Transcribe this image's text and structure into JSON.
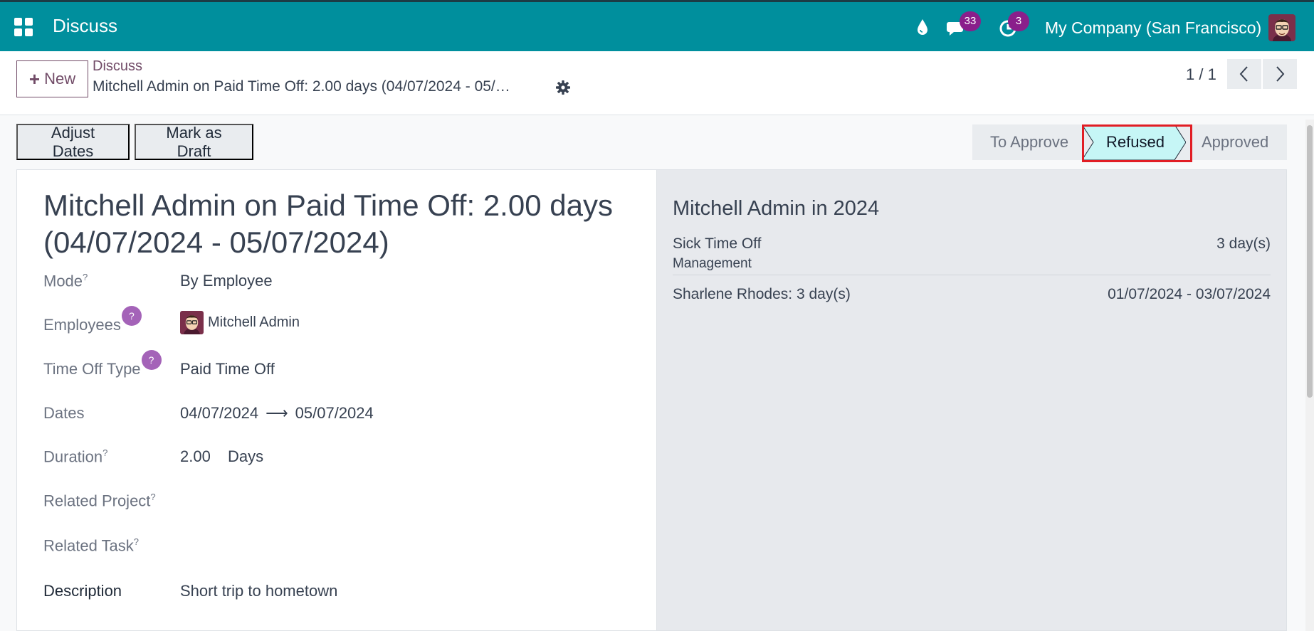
{
  "navbar": {
    "app_title": "Discuss",
    "messages_count": "33",
    "activities_count": "3",
    "company": "My Company (San Francisco)",
    "bg_color": "#008f9d",
    "icons": [
      "apps-grid-icon",
      "droplet-icon",
      "chat-icon",
      "clock-icon",
      "user-avatar"
    ]
  },
  "control": {
    "new_label": "New",
    "breadcrumb": "Discuss",
    "record_name": "Mitchell Admin on Paid Time Off: 2.00 days (04/07/2024 - 05/…",
    "pager": "1 / 1"
  },
  "actions": {
    "adjust_dates": "Adjust Dates",
    "mark_as_draft": "Mark as Draft"
  },
  "status": {
    "stages": [
      "To Approve",
      "Refused",
      "Approved"
    ],
    "current": "Refused",
    "active_color": "#c6f6f6"
  },
  "form": {
    "title": "Mitchell Admin on Paid Time Off: 2.00 days (04/07/2024 - 05/07/2024)",
    "mode_label": "Mode",
    "mode_value": "By Employee",
    "employees_label": "Employees",
    "employees_value": "Mitchell Admin",
    "type_label": "Time Off Type",
    "type_value": "Paid Time Off",
    "dates_label": "Dates",
    "date_from": "04/07/2024",
    "date_to": "05/07/2024",
    "duration_label": "Duration",
    "duration_value": "2.00",
    "duration_unit": "Days",
    "project_label": "Related Project",
    "task_label": "Related Task",
    "description_label": "Description",
    "description_value": "Short trip to hometown",
    "help_mark": "?"
  },
  "side": {
    "title": "Mitchell Admin in 2024",
    "leave_type": "Sick Time Off",
    "leave_days": "3 day(s)",
    "department": "Management",
    "entry_name": "Sharlene Rhodes: 3 day(s)",
    "entry_dates": "01/07/2024 - 03/07/2024"
  }
}
